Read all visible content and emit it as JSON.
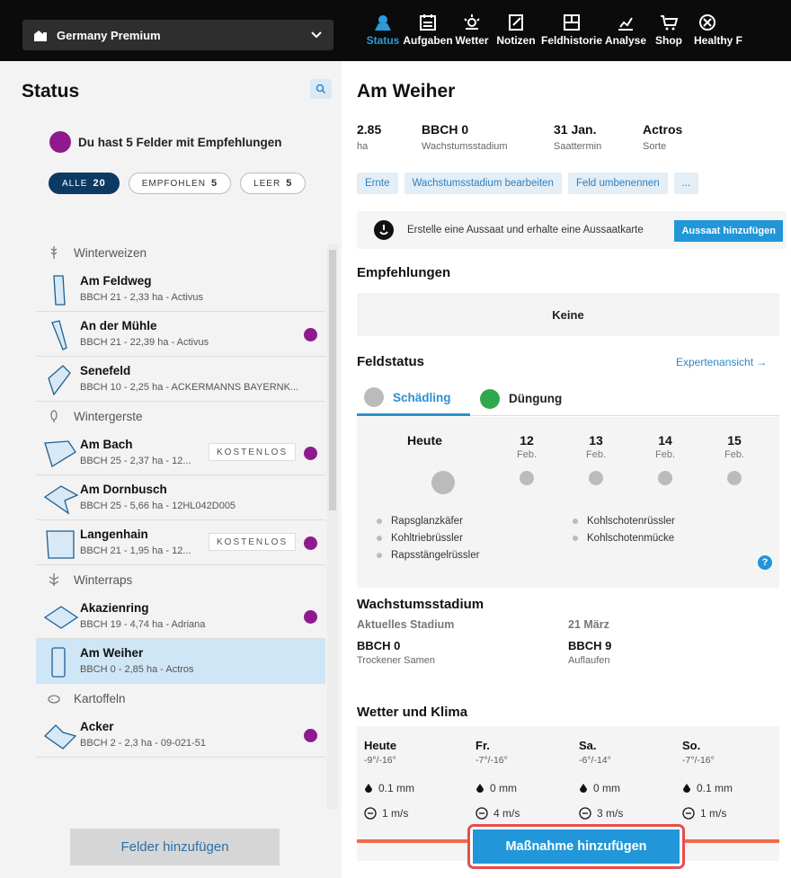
{
  "farm": {
    "name": "Germany Premium"
  },
  "nav": [
    {
      "label": "Status",
      "icon": "status-icon",
      "active": true
    },
    {
      "label": "Aufgaben",
      "icon": "tasks-icon"
    },
    {
      "label": "Wetter",
      "icon": "weather-icon"
    },
    {
      "label": "Notizen",
      "icon": "notes-icon"
    },
    {
      "label": "Feldhistorie",
      "icon": "field-history-icon"
    },
    {
      "label": "Analyse",
      "icon": "analysis-icon"
    },
    {
      "label": "Shop",
      "icon": "shop-icon"
    },
    {
      "label": "Healthy F",
      "icon": "healthy-icon"
    }
  ],
  "left": {
    "title": "Status",
    "recommendation_text": "Du hast 5 Felder mit Empfehlungen",
    "filters": [
      {
        "label": "ALLE",
        "count": "20",
        "active": true
      },
      {
        "label": "EMPFOHLEN",
        "count": "5"
      },
      {
        "label": "LEER",
        "count": "5"
      }
    ],
    "groups": [
      {
        "name": "Winterweizen",
        "fields": [
          {
            "name": "Am Feldweg",
            "meta": "BBCH 21 - 2,33 ha - Activus",
            "dot": false
          },
          {
            "name": "An der Mühle",
            "meta": "BBCH 21 - 22,39 ha - Activus",
            "dot": true
          },
          {
            "name": "Senefeld",
            "meta": "BBCH 10 - 2,25 ha - ACKERMANNS BAYERNK...",
            "dot": false
          }
        ]
      },
      {
        "name": "Wintergerste",
        "fields": [
          {
            "name": "Am Bach",
            "meta": "BBCH 25 - 2,37 ha - 12...",
            "tag": "KOSTENLOS",
            "dot": true
          },
          {
            "name": "Am Dornbusch",
            "meta": "BBCH 25 - 5,66 ha - 12HL042D005",
            "dot": false
          },
          {
            "name": "Langenhain",
            "meta": "BBCH 21 - 1,95 ha - 12...",
            "tag": "KOSTENLOS",
            "dot": true
          }
        ]
      },
      {
        "name": "Winterraps",
        "fields": [
          {
            "name": "Akazienring",
            "meta": "BBCH 19 - 4,74 ha - Adriana",
            "dot": true
          },
          {
            "name": "Am Weiher",
            "meta": "BBCH 0 - 2,85 ha - Actros",
            "dot": false,
            "selected": true
          }
        ]
      },
      {
        "name": "Kartoffeln",
        "fields": [
          {
            "name": "Acker",
            "meta": "BBCH 2 - 2,3 ha - 09-021-51",
            "dot": true
          }
        ]
      }
    ],
    "add_fields": "Felder hinzufügen"
  },
  "field": {
    "title": "Am Weiher",
    "facts": [
      {
        "value": "2.85",
        "label": "ha"
      },
      {
        "value": "BBCH 0",
        "label": "Wachstumsstadium"
      },
      {
        "value": "31 Jan.",
        "label": "Saattermin"
      },
      {
        "value": "Actros",
        "label": "Sorte"
      }
    ],
    "actions": [
      "Ernte",
      "Wachstumsstadium bearbeiten",
      "Feld umbenennen",
      "..."
    ],
    "sowing_text": "Erstelle eine Aussaat und erhalte eine Aussaatkarte",
    "sowing_button": "Aussaat hinzufügen"
  },
  "recommendations": {
    "heading": "Empfehlungen",
    "empty": "Keine"
  },
  "fieldstatus": {
    "heading": "Feldstatus",
    "expert_link": "Expertenansicht →",
    "tabs": [
      "Schädling",
      "Düngung"
    ],
    "days": [
      {
        "name": "Heute",
        "month": ""
      },
      {
        "name": "12",
        "month": "Feb."
      },
      {
        "name": "13",
        "month": "Feb."
      },
      {
        "name": "14",
        "month": "Feb."
      },
      {
        "name": "15",
        "month": "Feb."
      }
    ],
    "pests_left": [
      "Rapsglanzkäfer",
      "Kohltriebrüssler",
      "Rapsstängelrüssler"
    ],
    "pests_right": [
      "Kohlschotenrüssler",
      "Kohlschotenmücke"
    ],
    "help": "?"
  },
  "growth": {
    "heading": "Wachstumsstadium",
    "current_label": "Aktuelles Stadium",
    "current_value": "BBCH 0",
    "current_sub": "Trockener Samen",
    "next_label": "21 März",
    "next_value": "BBCH 9",
    "next_sub": "Auflaufen"
  },
  "weather": {
    "heading": "Wetter und Klima",
    "days": [
      {
        "name": "Heute",
        "temp": "-9°/-16°",
        "rain": "0.1 mm",
        "wind": "1 m/s"
      },
      {
        "name": "Fr.",
        "temp": "-7°/-16°",
        "rain": "0 mm",
        "wind": "4 m/s"
      },
      {
        "name": "Sa.",
        "temp": "-6°/-14°",
        "rain": "0 mm",
        "wind": "3 m/s"
      },
      {
        "name": "So.",
        "temp": "-7°/-16°",
        "rain": "0.1 mm",
        "wind": "1 m/s"
      }
    ]
  },
  "primary_action": "Maßnahme hinzufügen",
  "colors": {
    "accent": "#2196d8",
    "recommendation": "#8e1a8e",
    "highlight": "#e94c4c"
  }
}
